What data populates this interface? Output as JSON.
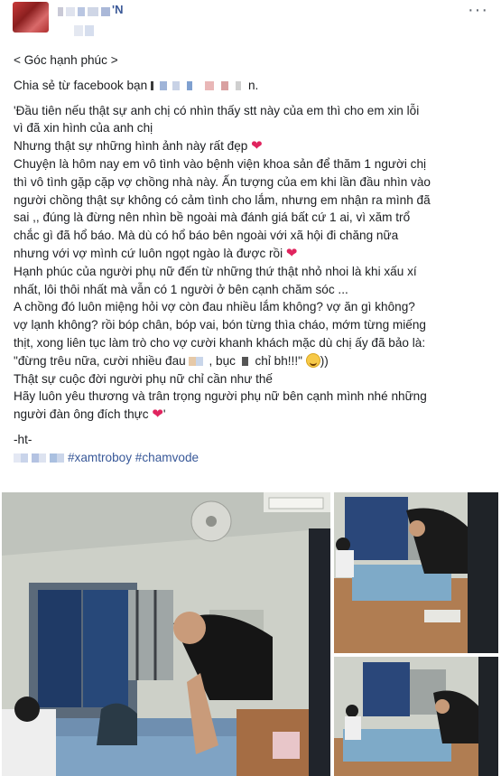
{
  "post": {
    "author_suffix": "'N",
    "more_label": "···"
  },
  "text": {
    "line1": "< Góc hạnh phúc >",
    "line2_prefix": "Chia sẻ từ facebook bạn ",
    "line2_suffix": "n.",
    "l3": "'Đầu tiên nếu thật sự anh chị có nhìn thấy stt này của em thì cho em xin lỗi",
    "l4": "vì đã xin hình của anh chị",
    "l5": "Nhưng thật sự những hình ảnh này rất đẹp",
    "l6": "Chuyện là hôm nay em vô tình vào bệnh viện khoa sản để thăm 1 người chị",
    "l7": "thì vô tình gặp cặp vợ chồng nhà này. Ấn tượng của em khi lần đầu nhìn vào",
    "l8": "người chồng thật sự không có cảm tình cho lắm, nhưng em nhận ra mình đã",
    "l9": "sai ,, đúng là đừng nên nhìn bề ngoài mà đánh giá bất cứ 1 ai, vì xăm trổ",
    "l10": "chắc gì đã hổ báo. Mà dù có hổ báo bên ngoài với xã hội đi chăng nữa",
    "l11": "nhưng với vợ mình cứ luôn ngọt ngào là được rồi",
    "l12": "Hạnh phúc của người phụ nữ đến từ những thứ thật nhỏ nhoi là khi xấu xí",
    "l13": "nhất, lôi thôi nhất mà vẫn có 1 người ở bên cạnh chăm sóc ...",
    "l14": "A chồng đó luôn miệng hỏi vợ còn đau nhiều lắm không? vợ ăn gì không?",
    "l15": "vợ lạnh không? rồi bóp chân, bóp vai, bón từng thìa cháo, mớm từng miếng",
    "l16": "thịt, xong liên tục làm trò cho vợ cười khanh khách mặc dù chị ấy đã bảo là:",
    "l17a": "\"đừng trêu nữa, cười nhiều đau ",
    "l17b": ", bục ",
    "l17c": " chỉ bh!!!\" ",
    "l17d": "))",
    "l18": "Thật sự cuộc đời người phụ nữ chỉ cần như thế",
    "l19": "Hãy luôn yêu thương và trân trọng người phụ nữ bên cạnh mình nhé những",
    "l20": "người đàn ông đích thực ",
    "l20_end": "'",
    "sig": "-ht-",
    "tags": "#xamtroboy #chamvode",
    "heart": "❤"
  },
  "colors": {
    "accent": "#385898",
    "heart": "#e0245e",
    "text": "#1c1e21"
  }
}
